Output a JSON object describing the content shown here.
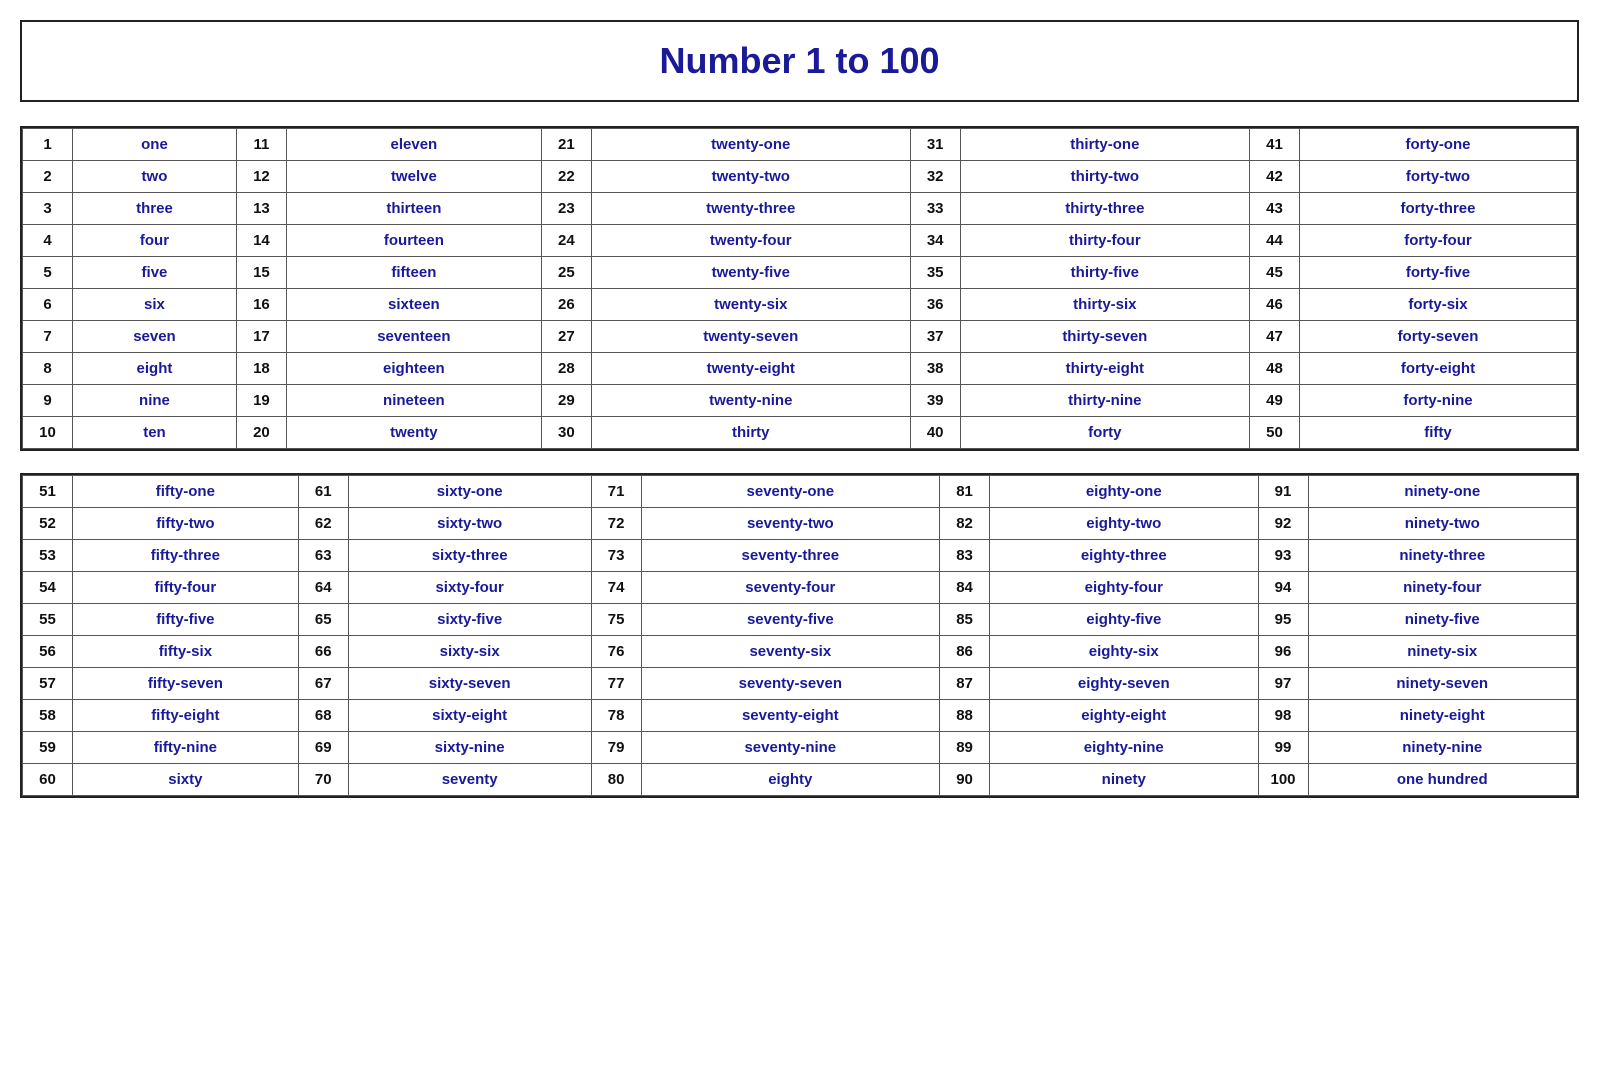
{
  "title": "Number 1 to 100",
  "table1": [
    [
      1,
      "one",
      11,
      "eleven",
      21,
      "twenty-one",
      31,
      "thirty-one",
      41,
      "forty-one"
    ],
    [
      2,
      "two",
      12,
      "twelve",
      22,
      "twenty-two",
      32,
      "thirty-two",
      42,
      "forty-two"
    ],
    [
      3,
      "three",
      13,
      "thirteen",
      23,
      "twenty-three",
      33,
      "thirty-three",
      43,
      "forty-three"
    ],
    [
      4,
      "four",
      14,
      "fourteen",
      24,
      "twenty-four",
      34,
      "thirty-four",
      44,
      "forty-four"
    ],
    [
      5,
      "five",
      15,
      "fifteen",
      25,
      "twenty-five",
      35,
      "thirty-five",
      45,
      "forty-five"
    ],
    [
      6,
      "six",
      16,
      "sixteen",
      26,
      "twenty-six",
      36,
      "thirty-six",
      46,
      "forty-six"
    ],
    [
      7,
      "seven",
      17,
      "seventeen",
      27,
      "twenty-seven",
      37,
      "thirty-seven",
      47,
      "forty-seven"
    ],
    [
      8,
      "eight",
      18,
      "eighteen",
      28,
      "twenty-eight",
      38,
      "thirty-eight",
      48,
      "forty-eight"
    ],
    [
      9,
      "nine",
      19,
      "nineteen",
      29,
      "twenty-nine",
      39,
      "thirty-nine",
      49,
      "forty-nine"
    ],
    [
      10,
      "ten",
      20,
      "twenty",
      30,
      "thirty",
      40,
      "forty",
      50,
      "fifty"
    ]
  ],
  "table2": [
    [
      51,
      "fifty-one",
      61,
      "sixty-one",
      71,
      "seventy-one",
      81,
      "eighty-one",
      91,
      "ninety-one"
    ],
    [
      52,
      "fifty-two",
      62,
      "sixty-two",
      72,
      "seventy-two",
      82,
      "eighty-two",
      92,
      "ninety-two"
    ],
    [
      53,
      "fifty-three",
      63,
      "sixty-three",
      73,
      "seventy-three",
      83,
      "eighty-three",
      93,
      "ninety-three"
    ],
    [
      54,
      "fifty-four",
      64,
      "sixty-four",
      74,
      "seventy-four",
      84,
      "eighty-four",
      94,
      "ninety-four"
    ],
    [
      55,
      "fifty-five",
      65,
      "sixty-five",
      75,
      "seventy-five",
      85,
      "eighty-five",
      95,
      "ninety-five"
    ],
    [
      56,
      "fifty-six",
      66,
      "sixty-six",
      76,
      "seventy-six",
      86,
      "eighty-six",
      96,
      "ninety-six"
    ],
    [
      57,
      "fifty-seven",
      67,
      "sixty-seven",
      77,
      "seventy-seven",
      87,
      "eighty-seven",
      97,
      "ninety-seven"
    ],
    [
      58,
      "fifty-eight",
      68,
      "sixty-eight",
      78,
      "seventy-eight",
      88,
      "eighty-eight",
      98,
      "ninety-eight"
    ],
    [
      59,
      "fifty-nine",
      69,
      "sixty-nine",
      79,
      "seventy-nine",
      89,
      "eighty-nine",
      99,
      "ninety-nine"
    ],
    [
      60,
      "sixty",
      70,
      "seventy",
      80,
      "eighty",
      90,
      "ninety",
      100,
      "one hundred"
    ]
  ]
}
